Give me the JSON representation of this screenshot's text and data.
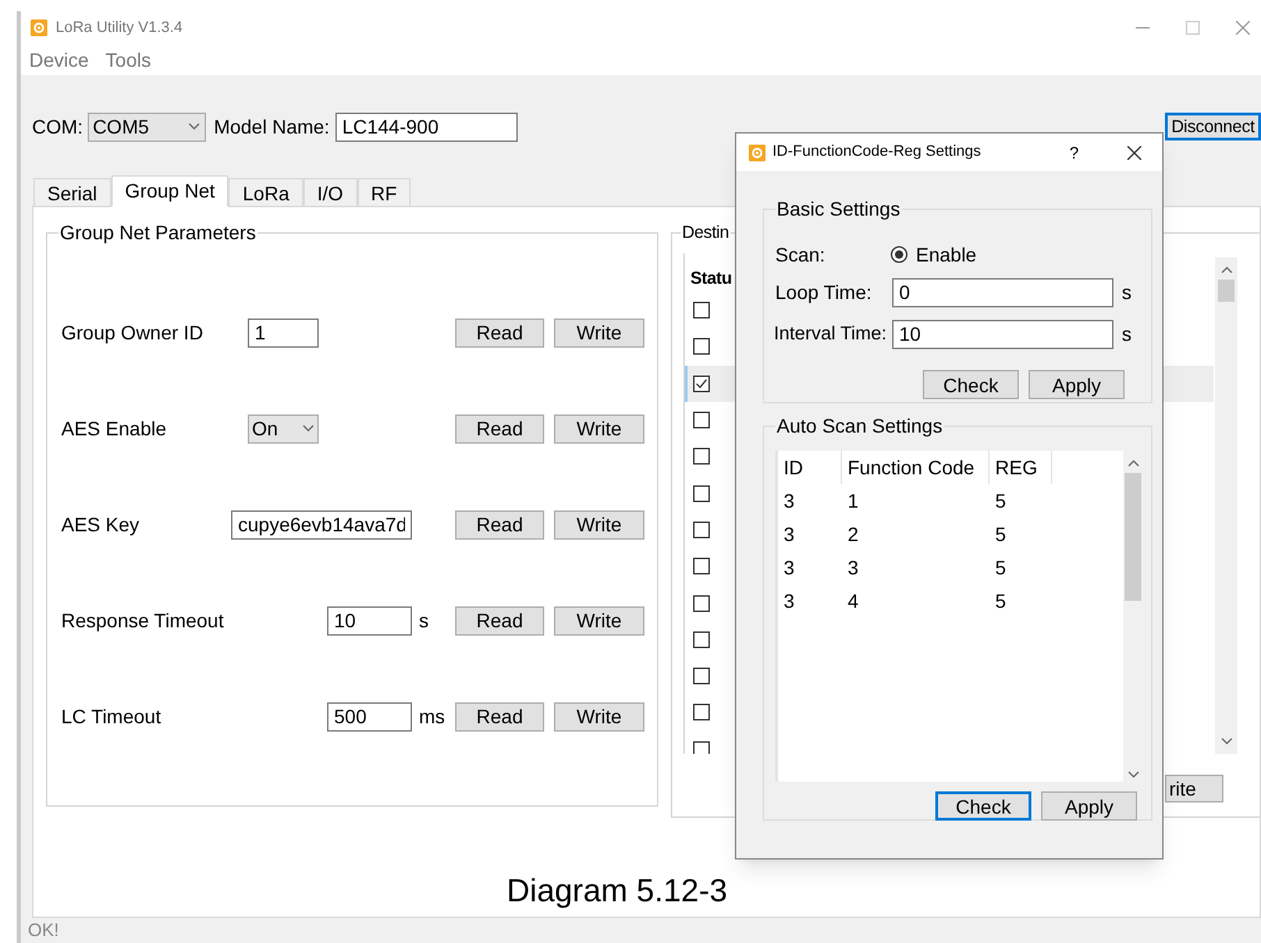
{
  "window": {
    "title": "LoRa Utility V1.3.4"
  },
  "menu": [
    {
      "label": "Device"
    },
    {
      "label": "Tools"
    }
  ],
  "connection": {
    "com_label": "COM:",
    "com_value": "COM5",
    "model_label": "Model Name:",
    "model_value": "LC144-900",
    "disconnect": "Disconnect"
  },
  "tabs": [
    {
      "label": "Serial",
      "selected": false
    },
    {
      "label": "Group Net",
      "selected": true
    },
    {
      "label": "LoRa",
      "selected": false
    },
    {
      "label": "I/O",
      "selected": false
    },
    {
      "label": "RF",
      "selected": false
    }
  ],
  "group_net": {
    "title": "Group Net Parameters",
    "rows": [
      {
        "label": "Group Owner ID",
        "kind": "text",
        "value": "1",
        "read": "Read",
        "write": "Write"
      },
      {
        "label": "AES Enable",
        "kind": "select",
        "value": "On",
        "read": "Read",
        "write": "Write"
      },
      {
        "label": "AES Key",
        "kind": "wide",
        "value": "cupye6evb14ava7d",
        "read": "Read",
        "write": "Write"
      },
      {
        "label": "Response Timeout",
        "kind": "unit",
        "value": "10",
        "unit": "s",
        "read": "Read",
        "write": "Write"
      },
      {
        "label": "LC Timeout",
        "kind": "unit",
        "value": "500",
        "unit": "ms",
        "read": "Read",
        "write": "Write"
      }
    ]
  },
  "destination": {
    "title": "Destin",
    "column_1": "Statu",
    "write": "rite",
    "rows": [
      {
        "checked": false,
        "selected": false
      },
      {
        "checked": false,
        "selected": false
      },
      {
        "checked": true,
        "selected": true
      },
      {
        "checked": false,
        "selected": false
      },
      {
        "checked": false,
        "selected": false
      },
      {
        "checked": false,
        "selected": false
      },
      {
        "checked": false,
        "selected": false
      },
      {
        "checked": false,
        "selected": false
      },
      {
        "checked": false,
        "selected": false
      },
      {
        "checked": false,
        "selected": false
      },
      {
        "checked": false,
        "selected": false
      },
      {
        "checked": false,
        "selected": false
      },
      {
        "checked": false,
        "selected": false
      }
    ]
  },
  "dialog": {
    "title": "ID-FunctionCode-Reg Settings",
    "help": "?",
    "basic": {
      "title": "Basic Settings",
      "scan_label": "Scan:",
      "scan_option": {
        "label": "Enable",
        "selected": true
      },
      "loop_label": "Loop Time:",
      "loop_value": "0",
      "loop_unit": "s",
      "interval_label": "Interval Time:",
      "interval_value": "10",
      "interval_unit": "s",
      "buttons": [
        {
          "label": "Check",
          "focused": false
        },
        {
          "label": "Apply",
          "focused": false
        }
      ]
    },
    "auto": {
      "title": "Auto Scan Settings",
      "columns": [
        "ID",
        "Function Code",
        "REG"
      ],
      "rows": [
        [
          "3",
          "1",
          "5"
        ],
        [
          "3",
          "2",
          "5"
        ],
        [
          "3",
          "3",
          "5"
        ],
        [
          "3",
          "4",
          "5"
        ]
      ],
      "buttons": [
        {
          "label": "Check",
          "focused": true
        },
        {
          "label": "Apply",
          "focused": false
        }
      ]
    }
  },
  "caption": "Diagram 5.12-3",
  "status_bar": "OK!"
}
